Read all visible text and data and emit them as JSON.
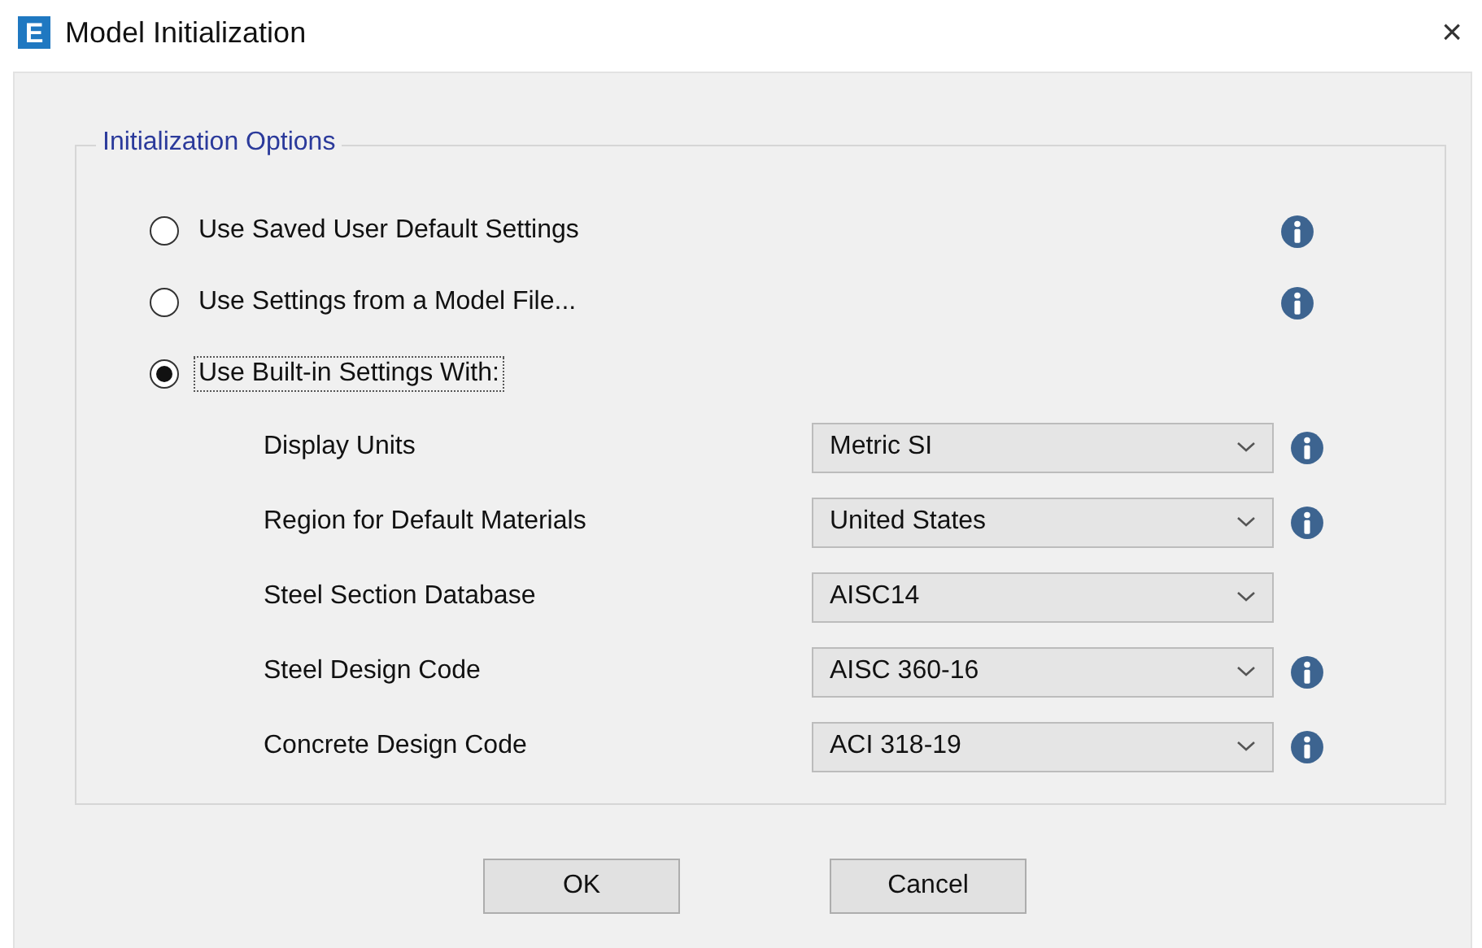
{
  "window": {
    "logo": "E",
    "title": "Model Initialization",
    "close": "×"
  },
  "group": {
    "title": "Initialization Options",
    "options": [
      {
        "label": "Use Saved User Default Settings",
        "selected": false,
        "info": true,
        "focused": false
      },
      {
        "label": "Use Settings from a Model File...",
        "selected": false,
        "info": true,
        "focused": false
      },
      {
        "label": "Use Built-in Settings With:",
        "selected": true,
        "info": false,
        "focused": true
      }
    ],
    "settings": [
      {
        "label": "Display Units",
        "value": "Metric SI",
        "info": true
      },
      {
        "label": "Region for Default Materials",
        "value": "United States",
        "info": true
      },
      {
        "label": "Steel Section Database",
        "value": "AISC14",
        "info": false
      },
      {
        "label": "Steel Design Code",
        "value": "AISC 360-16",
        "info": true
      },
      {
        "label": "Concrete Design Code",
        "value": "ACI 318-19",
        "info": true
      }
    ]
  },
  "buttons": [
    "OK",
    "Cancel"
  ]
}
